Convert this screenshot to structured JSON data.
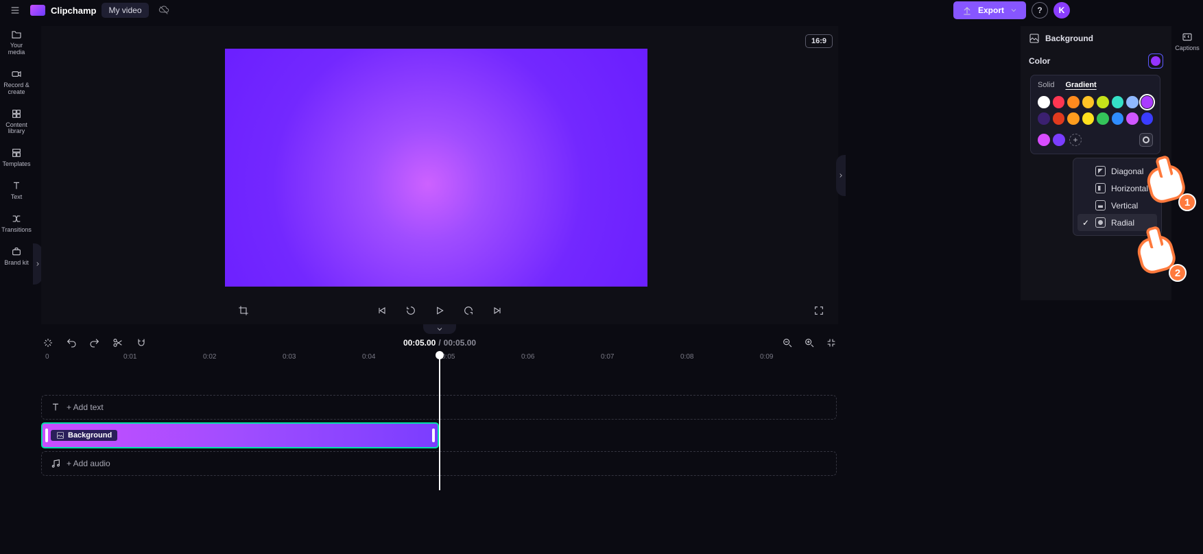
{
  "header": {
    "brand": "Clipchamp",
    "title": "My video",
    "export": "Export"
  },
  "avatar_letter": "K",
  "left_rail": {
    "items": [
      {
        "label": "Your media"
      },
      {
        "label": "Record & create"
      },
      {
        "label": "Content library"
      },
      {
        "label": "Templates"
      },
      {
        "label": "Text"
      },
      {
        "label": "Transitions"
      },
      {
        "label": "Brand kit"
      }
    ]
  },
  "stage": {
    "aspect": "16:9"
  },
  "timeline": {
    "current": "00:05.00",
    "separator": "/",
    "total": "00:05.00",
    "ruler": [
      "0",
      "0:01",
      "0:02",
      "0:03",
      "0:04",
      "0:05",
      "0:06",
      "0:07",
      "0:08",
      "0:09"
    ],
    "add_text": "+ Add text",
    "clip_label": "Background",
    "add_audio": "+ Add audio"
  },
  "inspector": {
    "section": "Background",
    "color_label": "Color"
  },
  "color_popover": {
    "tabs": {
      "solid": "Solid",
      "gradient": "Gradient"
    },
    "row1": [
      "#ffffff",
      "#ff3652",
      "#ff8a1e",
      "#ffc326",
      "#c6e21a",
      "#35e0c6",
      "#8fb8ff",
      "#a93aff"
    ],
    "row2": [
      "#3b2070",
      "#e03a1e",
      "#ff9d1e",
      "#ffe01e",
      "#34c45a",
      "#2f8dff",
      "#cf56ff",
      "#3a3cff"
    ],
    "custom": [
      "#d84cff",
      "#7b3dff"
    ]
  },
  "shape_menu": {
    "items": [
      "Diagonal",
      "Horizontal",
      "Vertical",
      "Radial"
    ],
    "selected": "Radial"
  },
  "right_rail": {
    "captions": "Captions"
  },
  "annotations": {
    "p1": "1",
    "p2": "2"
  }
}
